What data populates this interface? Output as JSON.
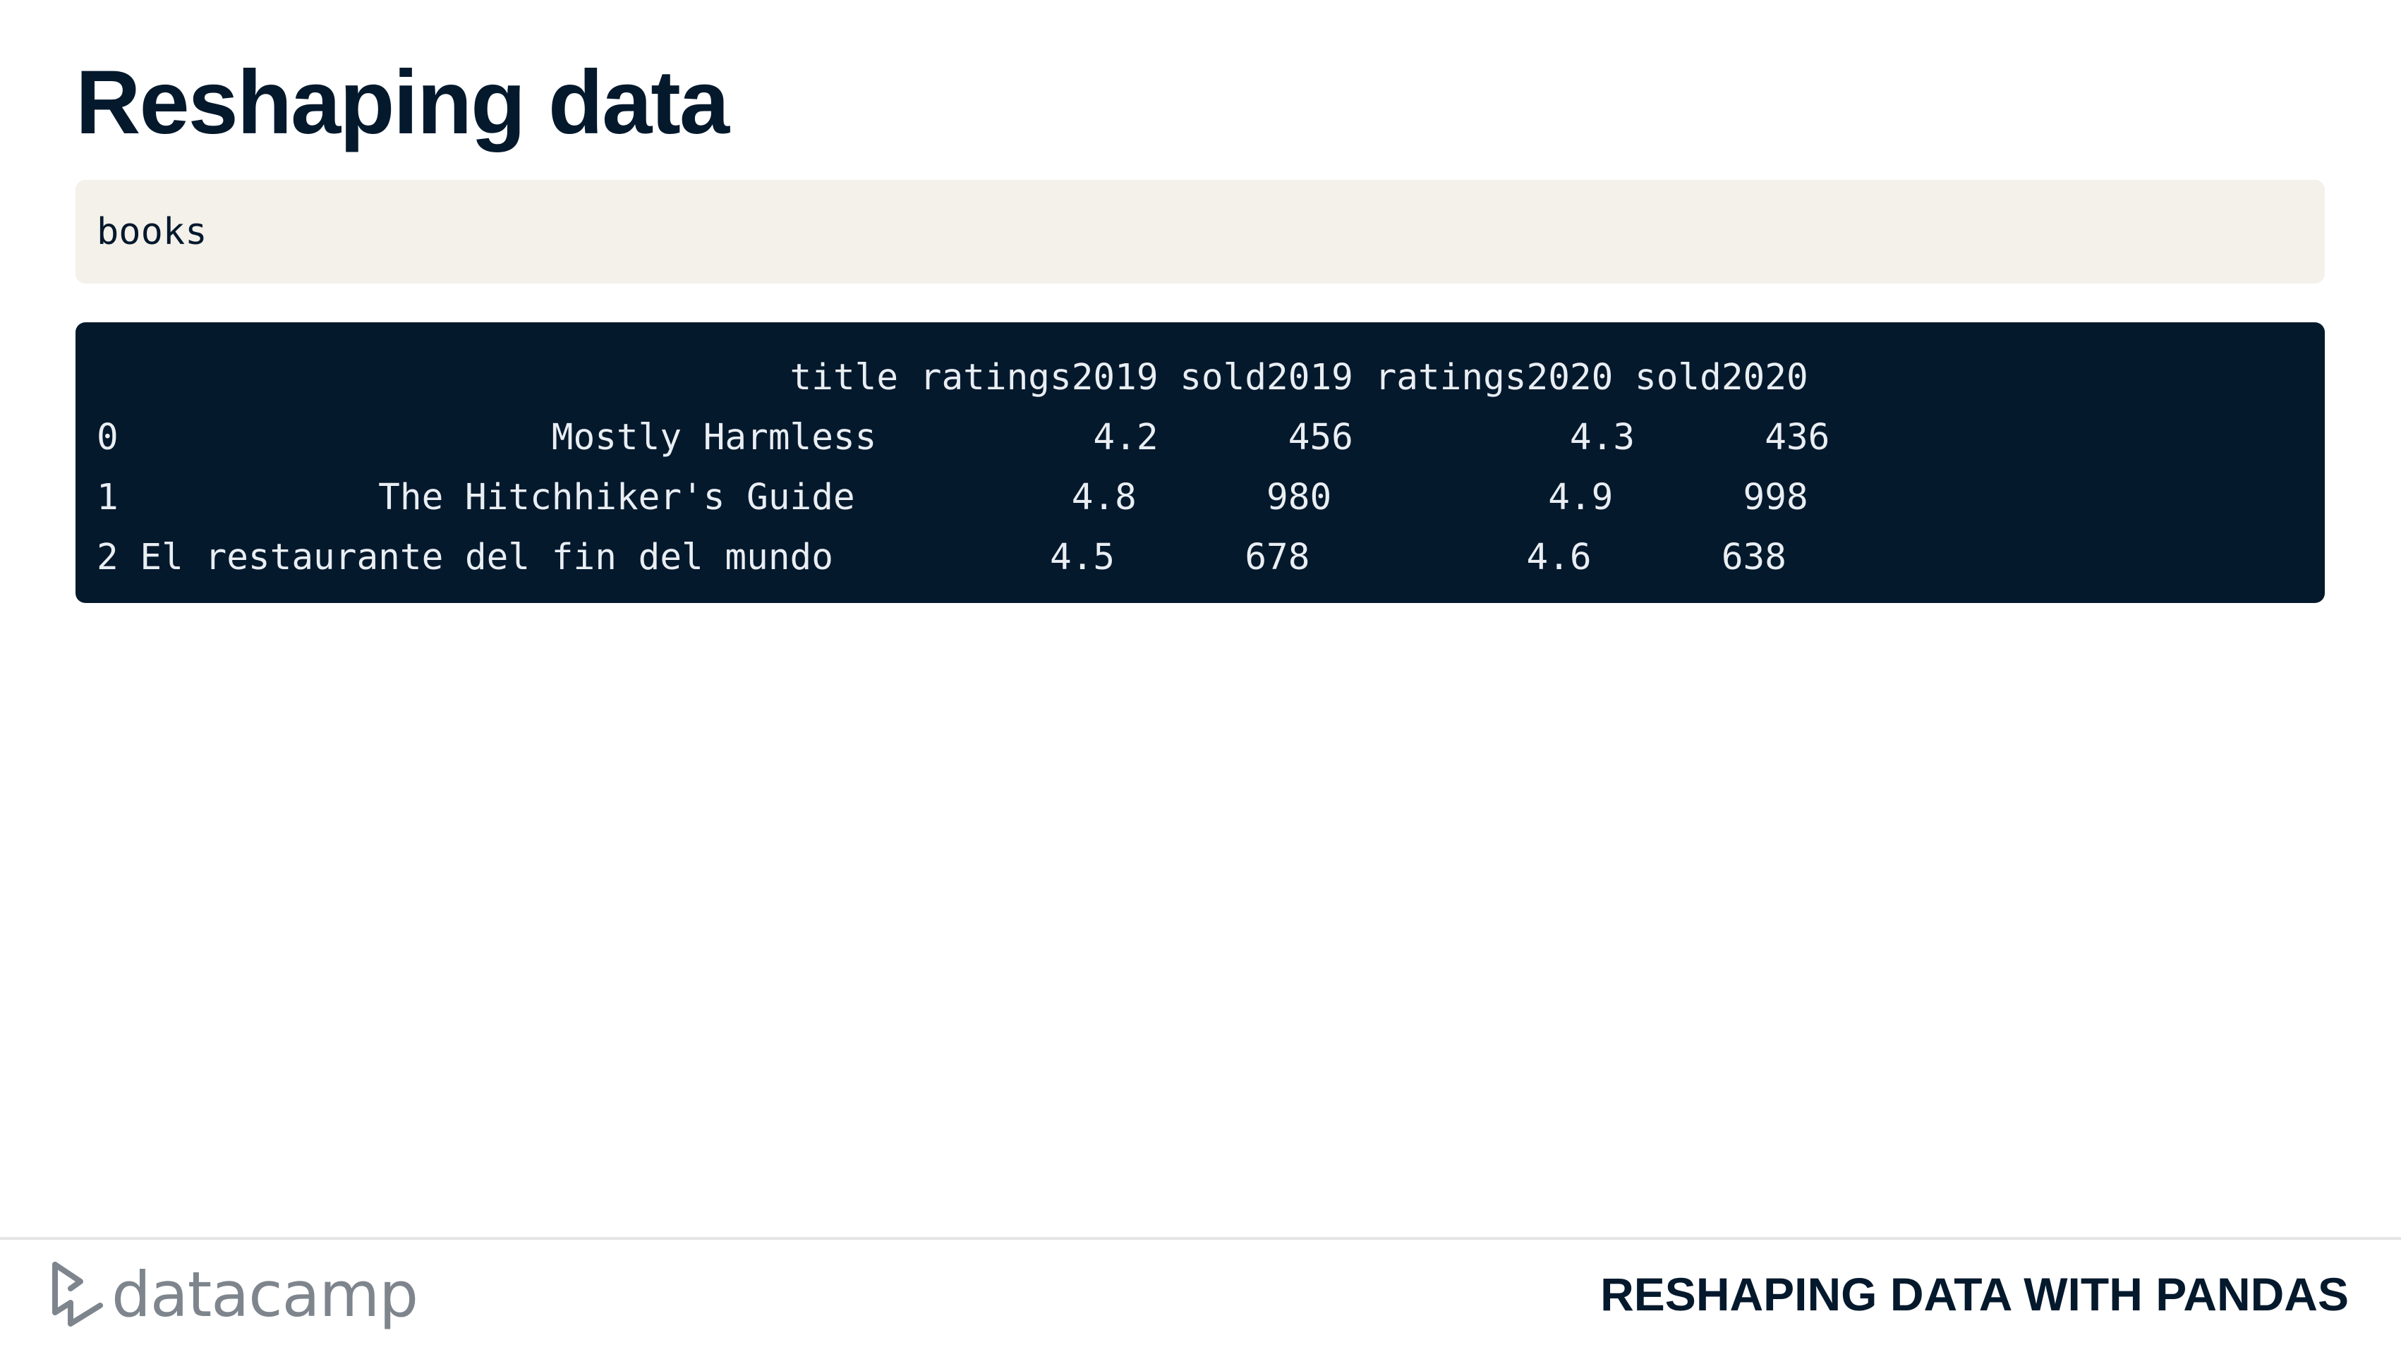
{
  "slide": {
    "title": "Reshaping data"
  },
  "code": {
    "input": "books",
    "output": "                                title ratings2019 sold2019 ratings2020 sold2020\n0                    Mostly Harmless          4.2      456          4.3      436\n1            The Hitchhiker's Guide          4.8      980          4.9      998\n2 El restaurante del fin del mundo          4.5      678          4.6      638"
  },
  "table": {
    "columns": [
      "title",
      "ratings2019",
      "sold2019",
      "ratings2020",
      "sold2020"
    ],
    "rows": [
      {
        "index": "0",
        "title": "Mostly Harmless",
        "ratings2019": "4.2",
        "sold2019": "456",
        "ratings2020": "4.3",
        "sold2020": "436"
      },
      {
        "index": "1",
        "title": "The Hitchhiker's Guide",
        "ratings2019": "4.8",
        "sold2019": "980",
        "ratings2020": "4.9",
        "sold2020": "998"
      },
      {
        "index": "2",
        "title": "El restaurante del fin del mundo",
        "ratings2019": "4.5",
        "sold2019": "678",
        "ratings2020": "4.6",
        "sold2020": "638"
      }
    ]
  },
  "footer": {
    "logo_text": "datacamp",
    "course_title": "RESHAPING DATA WITH PANDAS"
  },
  "colors": {
    "navy": "#05192d",
    "code_bg": "#f4f1ea",
    "logo_gray": "#7e858d"
  }
}
